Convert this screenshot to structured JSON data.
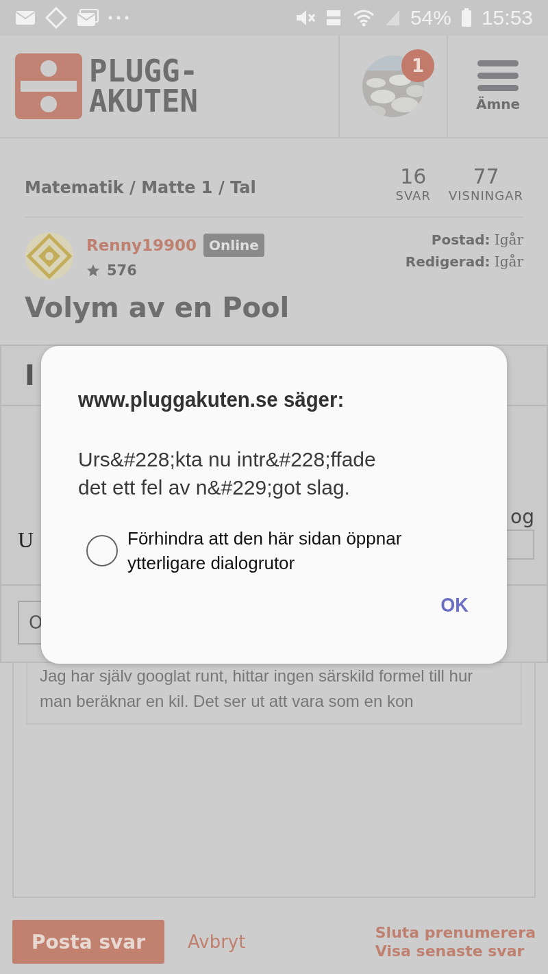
{
  "status_bar": {
    "battery": "54%",
    "time": "15:53"
  },
  "header": {
    "logo_line_1": "PLUGG-",
    "logo_line_2": "AKUTEN",
    "notification_count": "1",
    "menu_label": "Ämne"
  },
  "topic": {
    "breadcrumb": "Matematik / Matte 1 / Tal",
    "stats": [
      {
        "value": "16",
        "label": "SVAR"
      },
      {
        "value": "77",
        "label": "VISNINGAR"
      }
    ]
  },
  "post": {
    "author": "Renny19900",
    "status": "Online",
    "score": "576",
    "meta": [
      {
        "label": "Postad:",
        "value": "Igår"
      },
      {
        "label": "Redigerad:",
        "value": "Igår"
      }
    ],
    "title": "Volym av en Pool"
  },
  "background_panel": {
    "heading": "I",
    "label": "U",
    "side_text": "og",
    "field_text": "O"
  },
  "reply": {
    "quote": "Jag har själv googlat runt, hittar ingen särskild formel till hur man beräknar en kil. Det ser ut att vara som en kon"
  },
  "actions": {
    "submit": "Posta svar",
    "cancel": "Avbryt",
    "links": [
      "Sluta prenumerera",
      "Visa senaste svar"
    ]
  },
  "dialog": {
    "title": "www.pluggakuten.se säger:",
    "message": "Urs&#228;kta nu intr&#228;ffade det ett fel av n&#229;got slag.",
    "option": {
      "label": "Förhindra att den här sidan öppnar ytterligare dialogrutor",
      "checked": false
    },
    "ok": "OK"
  }
}
